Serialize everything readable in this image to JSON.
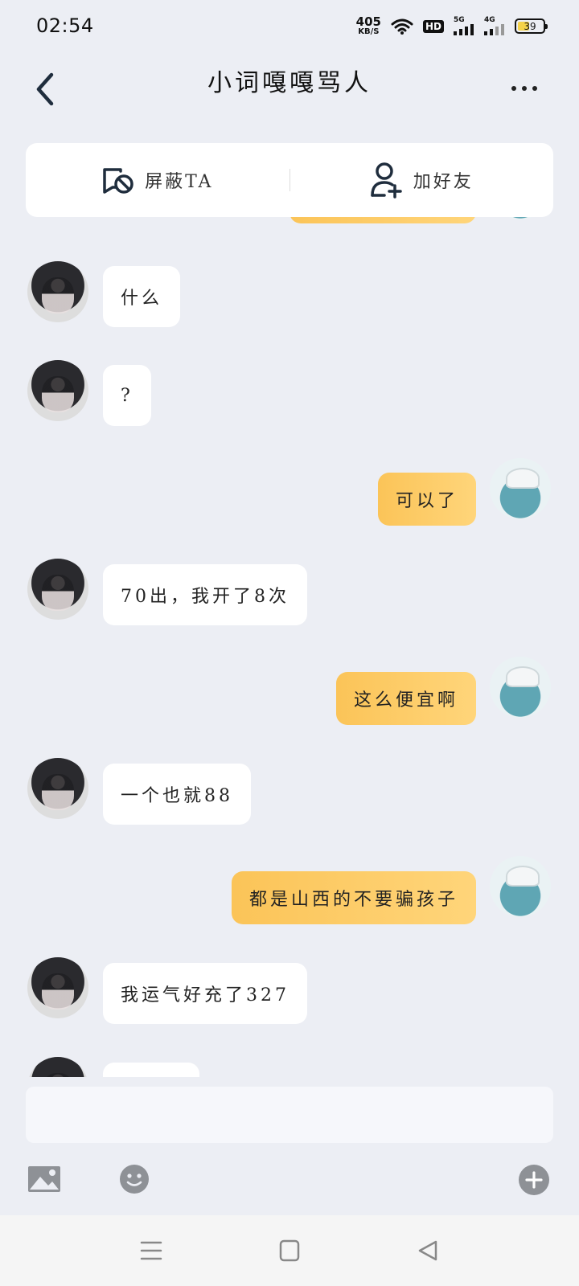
{
  "status_bar": {
    "time": "02:54",
    "net_speed": "405",
    "net_unit": "KB/S",
    "hd_label": "HD",
    "signal1_label": "5G",
    "signal2_label": "4G",
    "battery": "39"
  },
  "header": {
    "title": "小词嘎嘎骂人"
  },
  "actions": {
    "block_label": "屏蔽TA",
    "add_friend_label": "加好友"
  },
  "messages": [
    {
      "from": "peer",
      "text": "什么"
    },
    {
      "from": "peer",
      "text": "?"
    },
    {
      "from": "self",
      "text": "可以了"
    },
    {
      "from": "peer",
      "text": "70出，我开了8次"
    },
    {
      "from": "self",
      "text": "这么便宜啊"
    },
    {
      "from": "peer",
      "text": "一个也就88"
    },
    {
      "from": "self",
      "text": "都是山西的不要骗孩子"
    },
    {
      "from": "peer",
      "text": "我运气好充了327"
    }
  ],
  "colors": {
    "background": "#eceef4",
    "self_bubble": "#fbc458",
    "peer_bubble": "#ffffff",
    "icon_gray": "#8e9196"
  },
  "icons": {
    "back": "back-arrow-icon",
    "more": "more-dots-icon",
    "block": "block-user-icon",
    "add_friend": "add-friend-icon",
    "image": "image-icon",
    "emoji": "emoji-icon",
    "plus": "plus-icon"
  }
}
